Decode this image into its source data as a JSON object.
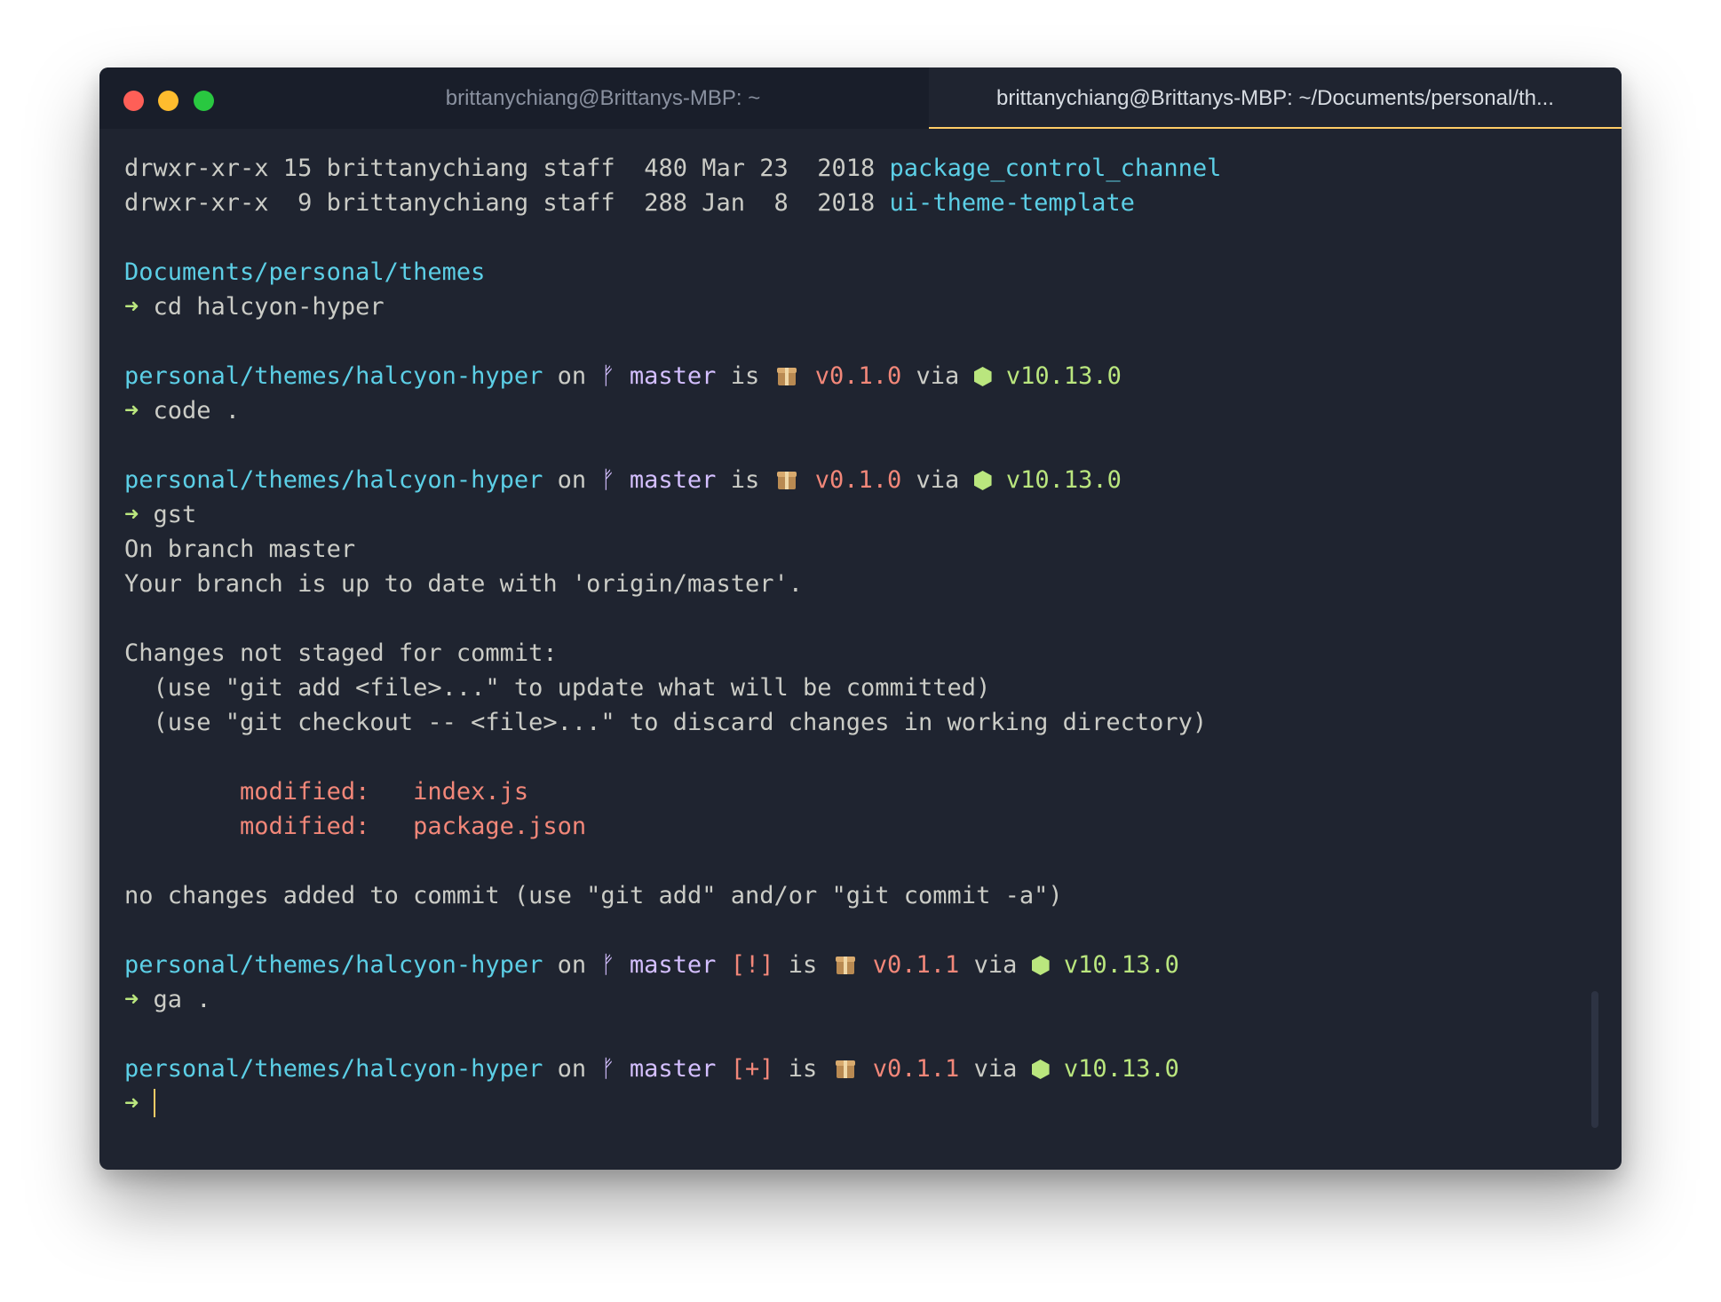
{
  "window": {
    "tabs": [
      {
        "label": "brittanychiang@Brittanys-MBP: ~",
        "active": false
      },
      {
        "label": "brittanychiang@Brittanys-MBP: ~/Documents/personal/th...",
        "active": true
      }
    ]
  },
  "terminal": {
    "ls_rows": [
      {
        "meta": "drwxr-xr-x 15 brittanychiang staff  480 Mar 23  2018 ",
        "name": "package_control_channel"
      },
      {
        "meta": "drwxr-xr-x  9 brittanychiang staff  288 Jan  8  2018 ",
        "name": "ui-theme-template"
      }
    ],
    "prompt1_path": "Documents/personal/themes",
    "arrow": "➜",
    "cmd1": " cd halcyon-hyper",
    "repo_path": "personal/themes/halcyon-hyper",
    "on": " on ",
    "branch_glyph": "ᚠ",
    "branch": " master",
    "is": " is ",
    "via": " via ",
    "pkg_version_1": "v0.1.0",
    "pkg_version_2": "v0.1.1",
    "node_version": "v10.13.0",
    "status_mod": " [!]",
    "status_add": " [+]",
    "cmd2": " code .",
    "cmd3": " gst",
    "gst_output": {
      "line1": "On branch master",
      "line2": "Your branch is up to date with 'origin/master'.",
      "line3": "Changes not staged for commit:",
      "line4": "  (use \"git add <file>...\" to update what will be committed)",
      "line5": "  (use \"git checkout -- <file>...\" to discard changes in working directory)",
      "modified_label": "        modified:   ",
      "file1": "index.js",
      "file2": "package.json",
      "line6": "no changes added to commit (use \"git add\" and/or \"git commit -a\")"
    },
    "cmd4": " ga ."
  },
  "colors": {
    "background": "#1f2430",
    "titlebar": "#191e2a",
    "path": "#5ccfe6",
    "branch": "#d4bfff",
    "version": "#f28779",
    "node": "#bae67e",
    "cursor": "#ffcc66"
  }
}
